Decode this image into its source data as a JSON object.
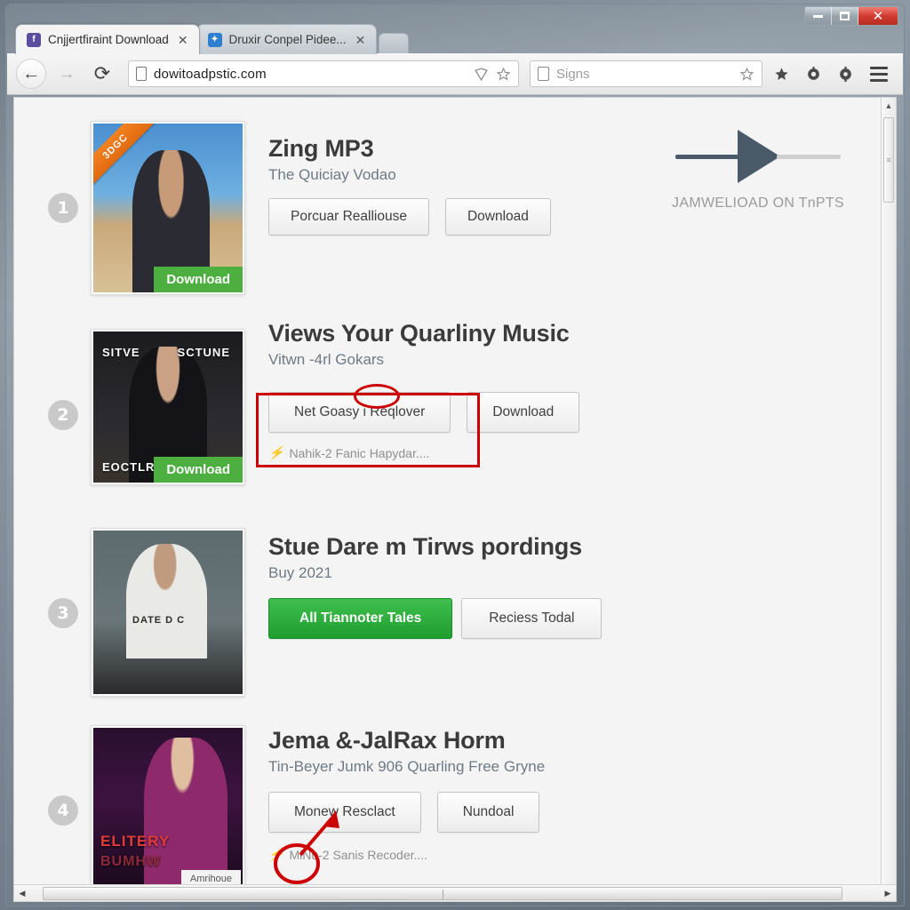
{
  "window": {
    "controls": {
      "minimize": "–",
      "maximize": "□",
      "close": "✕"
    }
  },
  "tabs": [
    {
      "title": "Cnjjertfiraint Download",
      "favicon": "facebook-icon",
      "close": "✕",
      "active": true
    },
    {
      "title": "Druxir Conpel Pidee...",
      "favicon": "twitter-icon",
      "close": "✕",
      "active": false
    }
  ],
  "toolbar": {
    "back": "←",
    "forward": "→",
    "reload": "⟳",
    "url": "dowitoadpstic.com",
    "search_placeholder": "Signs",
    "bookmark_star": "☆",
    "shield": "⛊",
    "star_filled": "★",
    "gear_1": "gear-icon",
    "gear_2": "gear-icon",
    "menu": "hamburger-menu-icon"
  },
  "player": {
    "play": "play-icon",
    "label": "JAMWELIOAD ON TnPTS"
  },
  "rows": [
    {
      "number": "1",
      "title": "Zing MP3",
      "subtitle": "The Quiciay Vodao",
      "ribbon": "3DGC",
      "thumb_badge": "Download",
      "buttons": [
        {
          "label": "Porcuar Realliouse",
          "style": "gray"
        },
        {
          "label": "Download",
          "style": "gray"
        }
      ],
      "caption": null,
      "overlays": []
    },
    {
      "number": "2",
      "title": "Views Your Quarliny Music",
      "subtitle": "Vitwn -4rl Gokars",
      "ribbon": null,
      "thumb_badge": "Download",
      "buttons": [
        {
          "label": "Net Goasy i Reqlover",
          "style": "gray"
        },
        {
          "label": "Download",
          "style": "gray"
        }
      ],
      "caption": "Nahik-2 Fanic Hapydar....",
      "caption_icon": "bolt-icon",
      "overlays": [
        "SITVE",
        "SCTUNE",
        "EOCTLR"
      ]
    },
    {
      "number": "3",
      "title": "Stue Dare m Tirws pordings",
      "subtitle": "Buy 2021",
      "ribbon": null,
      "thumb_badge": null,
      "buttons": [
        {
          "label": "All Tiannoter Tales",
          "style": "green"
        },
        {
          "label": "Reciess Todal",
          "style": "gray"
        }
      ],
      "caption": null,
      "overlays": [
        "DATE D C"
      ]
    },
    {
      "number": "4",
      "title": "Jema &-JalRax Horm",
      "subtitle": "Tin-Beyer Jumk 906 Quarling Free Gryne",
      "ribbon": null,
      "thumb_badge": null,
      "white_badge": "Amrihoue",
      "buttons": [
        {
          "label": "Monew Resclact",
          "style": "gray"
        },
        {
          "label": "Nundoal",
          "style": "gray"
        }
      ],
      "caption": "MiNu-2 Sanis Recoder....",
      "caption_icon": "bolt-icon",
      "overlays": [
        "ELITERY",
        "BUMHW"
      ]
    }
  ],
  "annotations": {
    "color": "#cc0000",
    "highlight_row": "2",
    "arrow_row": "4"
  },
  "scrollbars": {
    "v_up": "▲",
    "v_down": "▼",
    "h_left": "◀",
    "h_right": "▶"
  }
}
